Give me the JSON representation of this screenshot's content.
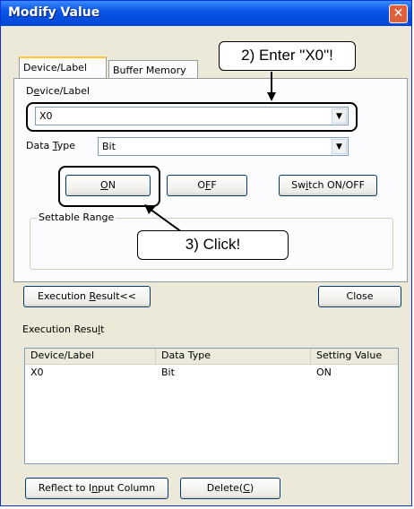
{
  "window": {
    "title": "Modify Value",
    "close_glyph": "✕"
  },
  "tabs": [
    {
      "label": "Device/Label"
    },
    {
      "label": "Buffer Memory"
    }
  ],
  "device_label": {
    "label_pre": "D",
    "label_acc": "e",
    "label_post": "vice/Label",
    "value": "X0"
  },
  "data_type": {
    "label_pre": "Data ",
    "label_acc": "T",
    "label_post": "ype",
    "value": "Bit"
  },
  "buttons": {
    "on": {
      "pre": "",
      "acc": "O",
      "post": "N"
    },
    "off": {
      "pre": "O",
      "acc": "F",
      "post": "F"
    },
    "switch": {
      "pre": "Sw",
      "acc": "i",
      "post": "tch ON/OFF"
    },
    "execution_result": {
      "pre": "Execution ",
      "acc": "R",
      "post": "esult<<"
    },
    "close": "Close",
    "reflect": {
      "pre": "Reflect to I",
      "acc": "n",
      "post": "put Column"
    },
    "delete": {
      "pre": "Delete(",
      "acc": "C",
      "post": ")"
    }
  },
  "settable_range": {
    "label": "Settable Range"
  },
  "execution_result": {
    "label_pre": "Execution Resu",
    "label_acc": "l",
    "label_post": "t",
    "columns": [
      "Device/Label",
      "Data Type",
      "Setting Value"
    ],
    "rows": [
      [
        "X0",
        "Bit",
        "ON"
      ]
    ]
  },
  "callouts": {
    "enter": "2) Enter \"X0\"!",
    "click": "3) Click!"
  },
  "colors": {
    "title_bar": "#0a55e6",
    "close_button": "#e0603d",
    "dialog_bg": "#ece9d8"
  }
}
